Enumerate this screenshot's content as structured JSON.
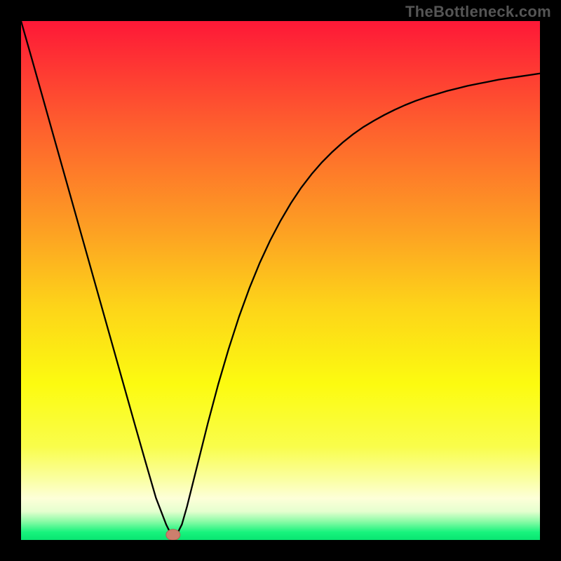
{
  "watermark": "TheBottleneck.com",
  "colors": {
    "frame": "#000000",
    "curve": "#000000",
    "marker_fill": "#cd7f6d",
    "marker_stroke": "#b26353",
    "gradient_stops": [
      {
        "offset": 0.0,
        "color": "#fe1837"
      },
      {
        "offset": 0.2,
        "color": "#fe5e2e"
      },
      {
        "offset": 0.4,
        "color": "#fd9f23"
      },
      {
        "offset": 0.55,
        "color": "#fdd419"
      },
      {
        "offset": 0.7,
        "color": "#fcfb10"
      },
      {
        "offset": 0.82,
        "color": "#f9fd4b"
      },
      {
        "offset": 0.88,
        "color": "#faff9e"
      },
      {
        "offset": 0.92,
        "color": "#fdffd8"
      },
      {
        "offset": 0.945,
        "color": "#e5ffcf"
      },
      {
        "offset": 0.965,
        "color": "#87fba5"
      },
      {
        "offset": 0.985,
        "color": "#17f37d"
      },
      {
        "offset": 1.0,
        "color": "#09e572"
      }
    ]
  },
  "chart_data": {
    "type": "line",
    "title": "",
    "xlabel": "",
    "ylabel": "",
    "xlim": [
      0,
      1
    ],
    "ylim": [
      0,
      1
    ],
    "x": [
      0.0,
      0.02,
      0.04,
      0.06,
      0.08,
      0.1,
      0.12,
      0.14,
      0.16,
      0.18,
      0.2,
      0.22,
      0.24,
      0.26,
      0.28,
      0.285,
      0.29,
      0.295,
      0.3,
      0.31,
      0.32,
      0.34,
      0.36,
      0.38,
      0.4,
      0.42,
      0.44,
      0.46,
      0.48,
      0.5,
      0.52,
      0.54,
      0.56,
      0.58,
      0.6,
      0.62,
      0.64,
      0.66,
      0.68,
      0.7,
      0.72,
      0.74,
      0.76,
      0.78,
      0.8,
      0.82,
      0.84,
      0.86,
      0.88,
      0.9,
      0.92,
      0.94,
      0.96,
      0.98,
      1.0
    ],
    "values": [
      1.0,
      0.93,
      0.859,
      0.788,
      0.717,
      0.646,
      0.575,
      0.504,
      0.433,
      0.362,
      0.291,
      0.22,
      0.15,
      0.081,
      0.029,
      0.019,
      0.011,
      0.006,
      0.01,
      0.03,
      0.065,
      0.145,
      0.225,
      0.3,
      0.368,
      0.43,
      0.485,
      0.534,
      0.577,
      0.615,
      0.649,
      0.679,
      0.705,
      0.728,
      0.748,
      0.766,
      0.782,
      0.796,
      0.808,
      0.819,
      0.829,
      0.838,
      0.846,
      0.853,
      0.859,
      0.865,
      0.87,
      0.875,
      0.879,
      0.883,
      0.887,
      0.89,
      0.893,
      0.896,
      0.899
    ],
    "marker": {
      "x": 0.293,
      "y": 0.01,
      "rx": 0.0135,
      "ry": 0.0105
    }
  }
}
